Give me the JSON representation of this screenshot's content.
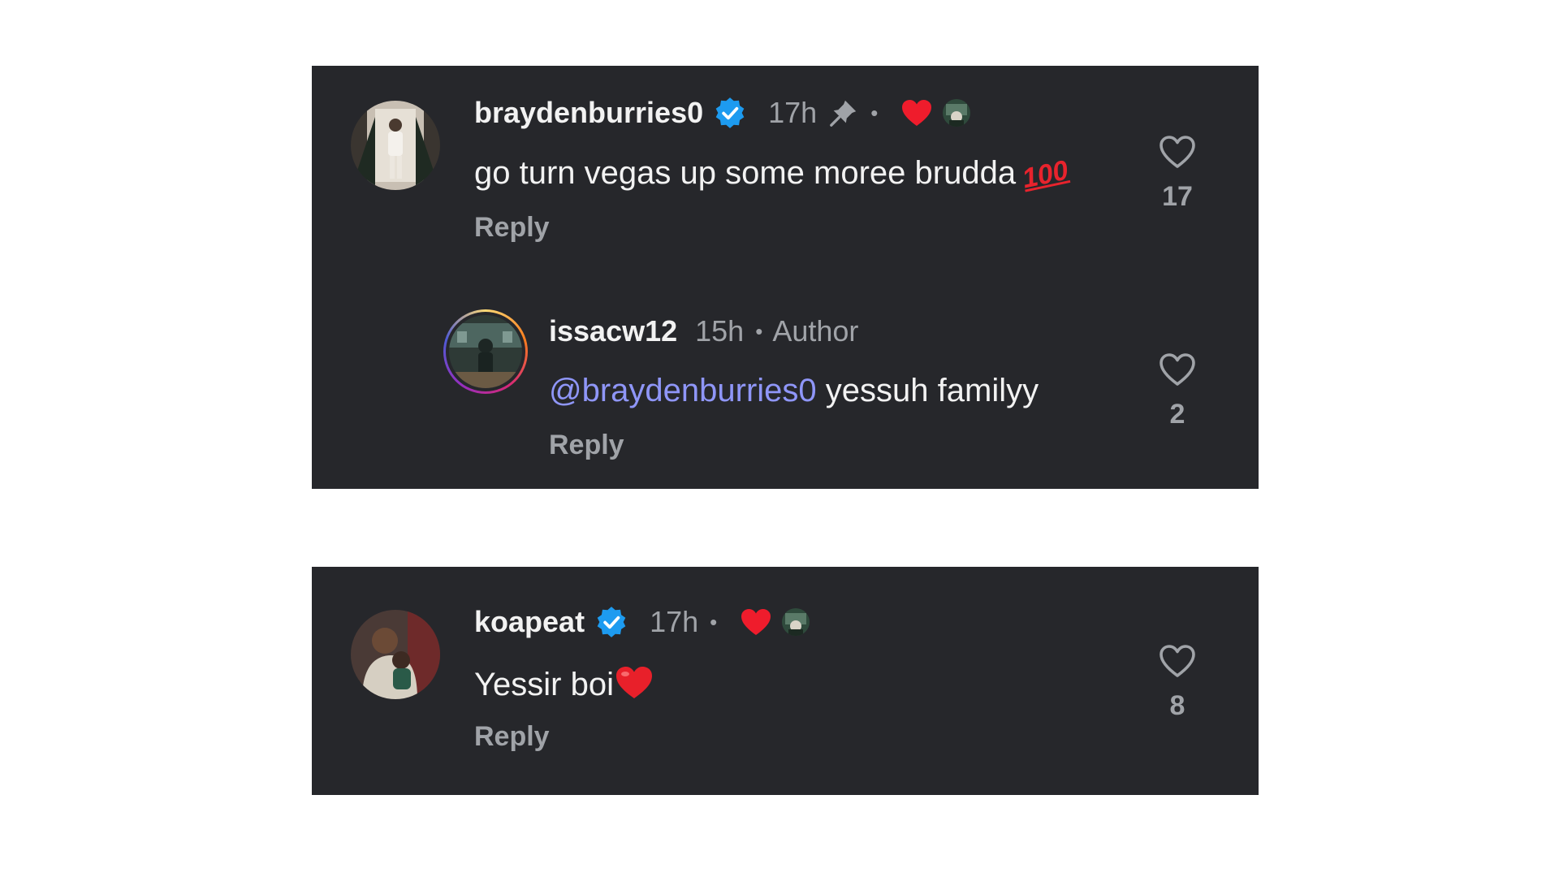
{
  "comments": [
    {
      "username": "braydenburries0",
      "verified": true,
      "time": "17h",
      "pinned": true,
      "liked_by_author": true,
      "text": "go turn vegas up some moree brudda",
      "emoji": "💯",
      "reply_label": "Reply",
      "like_count": "17",
      "replies": [
        {
          "username": "issacw12",
          "time": "15h",
          "author_label": "Author",
          "mention": "@braydenburries0",
          "text": " yessuh familyy",
          "reply_label": "Reply",
          "like_count": "2"
        }
      ]
    },
    {
      "username": "koapeat",
      "verified": true,
      "time": "17h",
      "liked_by_author": true,
      "text": "Yessir boi",
      "emoji": "❤️",
      "reply_label": "Reply",
      "like_count": "8"
    }
  ],
  "separator": "•",
  "colors": {
    "panel_bg": "#26272b",
    "text_primary": "#f2f2f2",
    "text_secondary": "#a0a3a8",
    "mention": "#8f96f8",
    "verified": "#1d9bf0",
    "heart_red": "#ef1c2c"
  },
  "icons": {
    "verified": "verified-badge-icon",
    "pin": "pin-icon",
    "liked_by_author": "red-heart-icon",
    "like": "heart-outline-icon"
  }
}
